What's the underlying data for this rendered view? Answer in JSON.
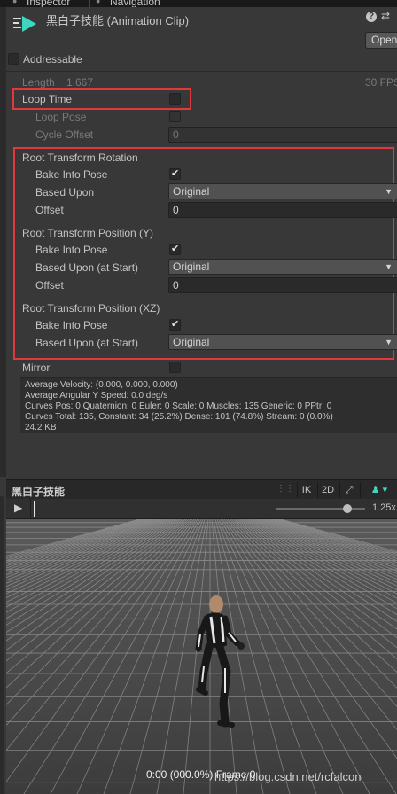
{
  "tabs": {
    "inspector": "Inspector",
    "navigation": "Navigation"
  },
  "header": {
    "title": "黑白子技能 (Animation Clip)",
    "open_label": "Open",
    "help_icon": "help-icon",
    "settings_icon": "sliders-icon",
    "clip_icon": "animation-clip-icon"
  },
  "addressable": {
    "label": "Addressable",
    "checked": false
  },
  "length_row": {
    "label": "Length",
    "value": "1.667",
    "fps": "30 FPS"
  },
  "loop": {
    "loop_time": "Loop Time",
    "loop_pose": "Loop Pose",
    "cycle_offset": "Cycle Offset",
    "cycle_offset_value": "0"
  },
  "root_rotation": {
    "header": "Root Transform Rotation",
    "bake_label": "Bake Into Pose",
    "based_label": "Based Upon",
    "based_value": "Original",
    "offset_label": "Offset",
    "offset_value": "0"
  },
  "root_pos_y": {
    "header": "Root Transform Position (Y)",
    "bake_label": "Bake Into Pose",
    "based_label": "Based Upon (at Start)",
    "based_value": "Original",
    "offset_label": "Offset",
    "offset_value": "0"
  },
  "root_pos_xz": {
    "header": "Root Transform Position (XZ)",
    "bake_label": "Bake Into Pose",
    "based_label": "Based Upon (at Start)",
    "based_value": "Original"
  },
  "mirror": {
    "label": "Mirror"
  },
  "stats": {
    "line1": "Average Velocity: (0.000, 0.000, 0.000)",
    "line2": "Average Angular Y Speed: 0.0 deg/s",
    "line3": "Curves Pos: 0 Quaternion: 0 Euler: 0 Scale: 0 Muscles: 135 Generic: 0 PPtr: 0",
    "line4": "Curves Total: 135, Constant: 34 (25.2%) Dense: 101 (74.8%) Stream: 0 (0.0%)",
    "line5": "24.2 KB"
  },
  "preview": {
    "title": "黑白子技能",
    "ik": "IK",
    "twod": "2D",
    "speed": "1.25x",
    "speed_fraction": 0.8,
    "frame_text": "0:00 (000.0%) Frame 0",
    "watermark": "https://blog.csdn.net/rcfalcon"
  },
  "colors": {
    "highlight": "#e0383b",
    "clip_icon": "#3dd6c0",
    "background": "#383838"
  }
}
